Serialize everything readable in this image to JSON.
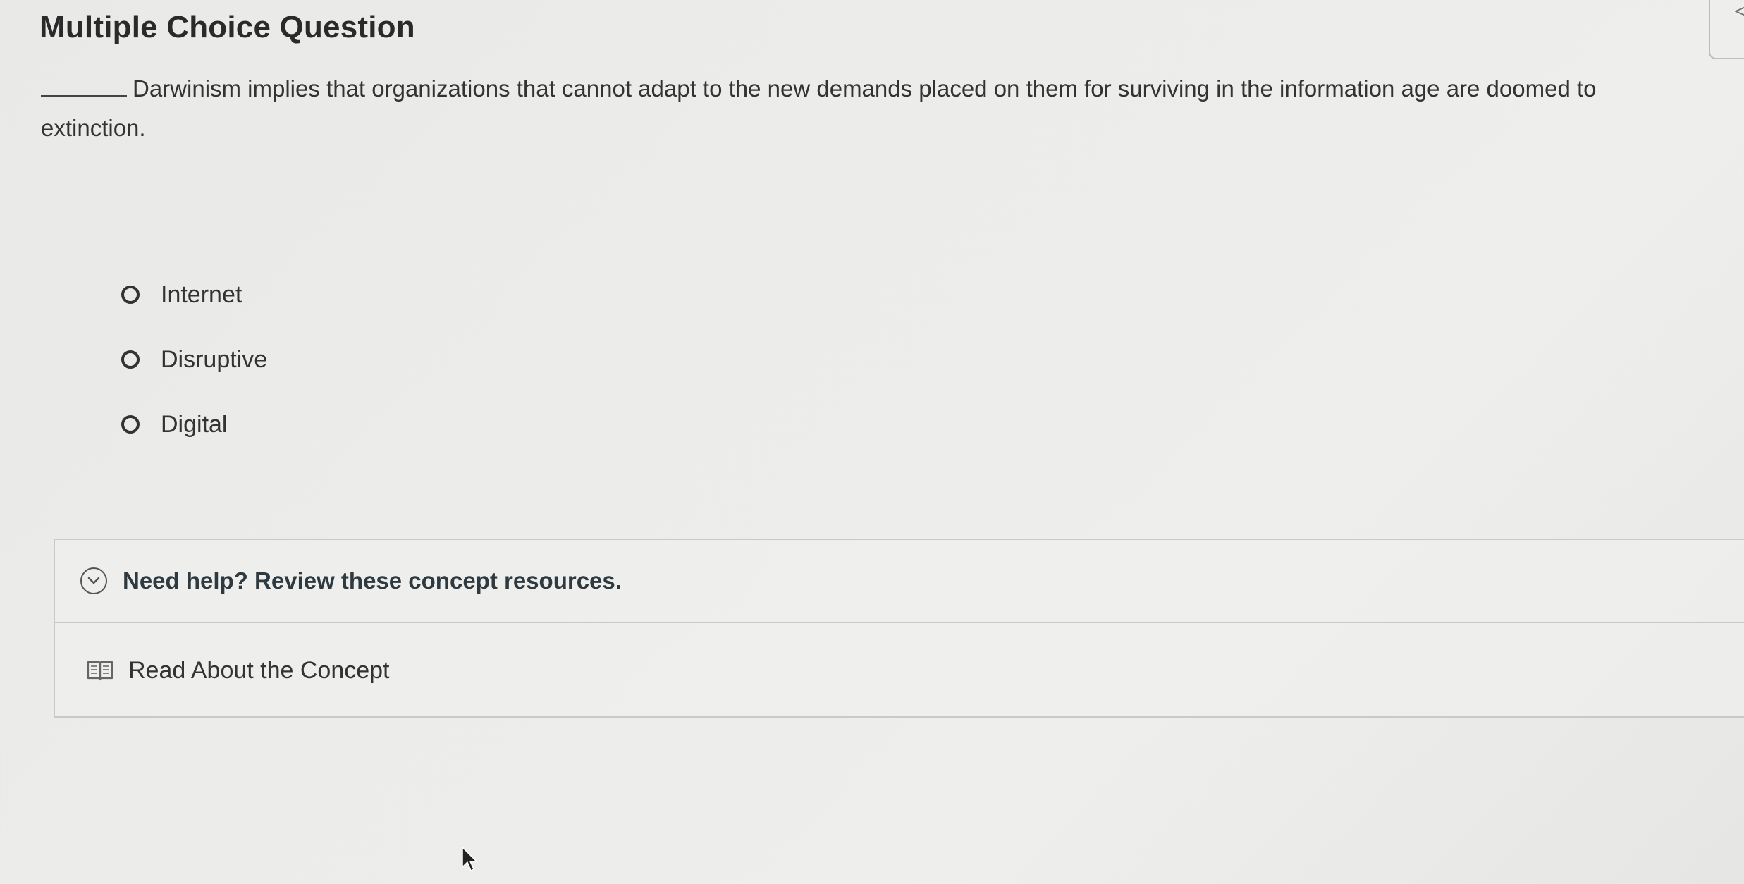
{
  "question": {
    "heading": "Multiple Choice Question",
    "text": "Darwinism implies that organizations that cannot adapt to the new demands placed on them for surviving in the information age are doomed to extinction."
  },
  "options": [
    {
      "label": "Internet",
      "selected": false
    },
    {
      "label": "Disruptive",
      "selected": false
    },
    {
      "label": "Digital",
      "selected": false
    }
  ],
  "help": {
    "title": "Need help? Review these concept resources.",
    "resource_label": "Read About the Concept",
    "icons": [
      "chevron-down-icon",
      "book-icon"
    ]
  },
  "icons": {
    "corner": "flag-icon",
    "cursor": "mouse-cursor-icon"
  }
}
